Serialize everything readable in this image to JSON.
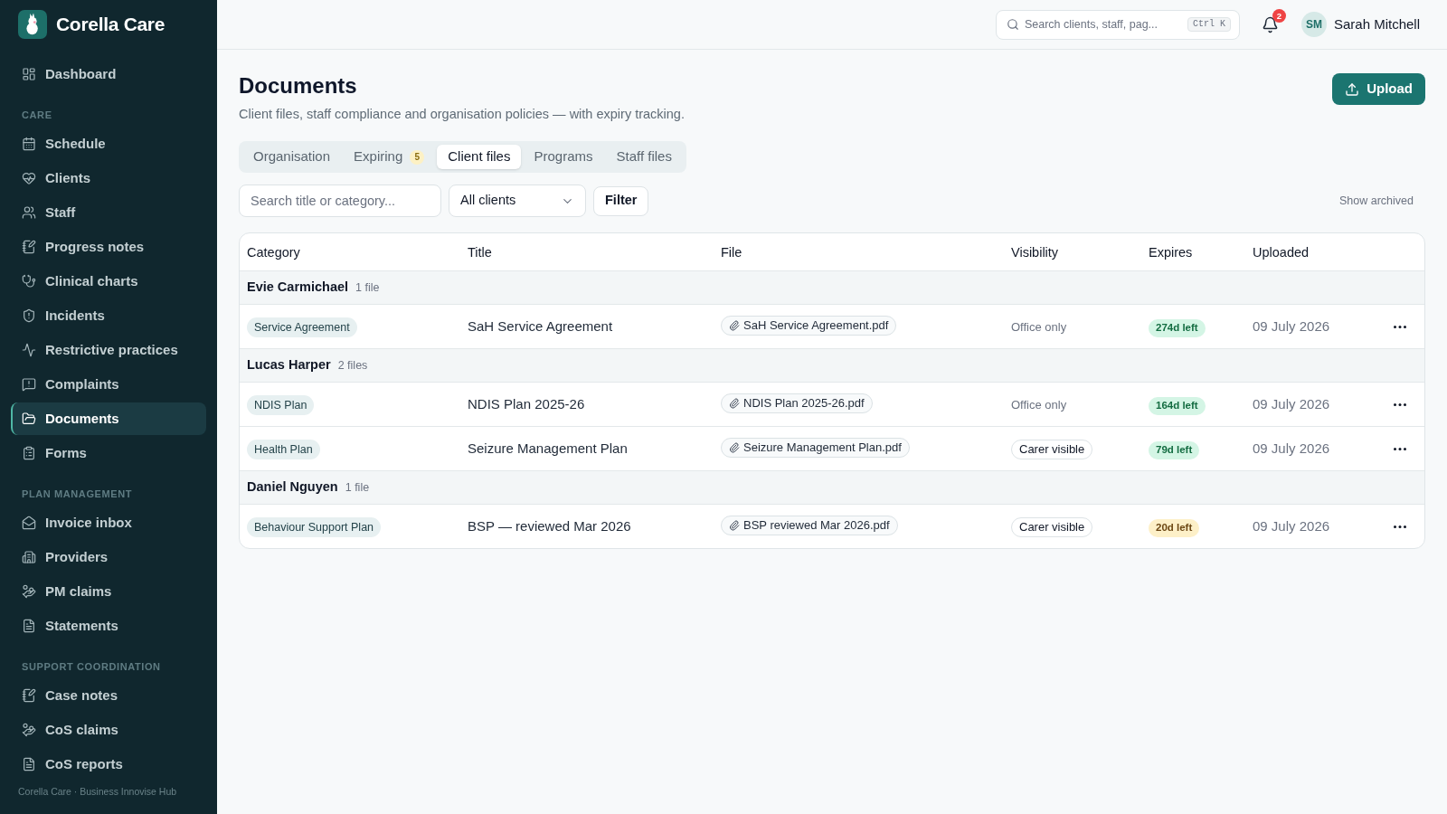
{
  "sidebar": {
    "brand": "Corella Care",
    "sections": [
      {
        "items": [
          {
            "label": "Dashboard",
            "selected": false
          }
        ]
      },
      {
        "heading": "CARE",
        "items": [
          {
            "label": "Schedule",
            "selected": false
          },
          {
            "label": "Clients",
            "selected": false
          },
          {
            "label": "Staff",
            "selected": false
          },
          {
            "label": "Progress notes",
            "selected": false
          },
          {
            "label": "Clinical charts",
            "selected": false
          },
          {
            "label": "Incidents",
            "selected": false
          },
          {
            "label": "Restrictive practices",
            "selected": false
          },
          {
            "label": "Complaints",
            "selected": false
          },
          {
            "label": "Documents",
            "selected": true
          },
          {
            "label": "Forms",
            "selected": false
          }
        ]
      },
      {
        "heading": "PLAN MANAGEMENT",
        "items": [
          {
            "label": "Invoice inbox",
            "selected": false
          },
          {
            "label": "Providers",
            "selected": false
          },
          {
            "label": "PM claims",
            "selected": false
          },
          {
            "label": "Statements",
            "selected": false
          }
        ]
      },
      {
        "heading": "SUPPORT COORDINATION",
        "items": [
          {
            "label": "Case notes",
            "selected": false
          },
          {
            "label": "CoS claims",
            "selected": false
          },
          {
            "label": "CoS reports",
            "selected": false
          }
        ]
      }
    ],
    "footer": "Corella Care · Business Innovise Hub"
  },
  "top_bar": {
    "search": {
      "placeholder": "Search clients, staff, pag...",
      "shortcut": "Ctrl K"
    },
    "notifications": {
      "count": "2"
    },
    "user": {
      "initials": "SM",
      "name": "Sarah Mitchell"
    }
  },
  "page": {
    "title": "Documents",
    "subtitle": "Client files, staff compliance and organisation policies — with expiry tracking.",
    "upload_button": "Upload",
    "tabs": [
      {
        "label": "Organisation",
        "selected": false
      },
      {
        "label": "Expiring",
        "badge": "5",
        "selected": false
      },
      {
        "label": "Client files",
        "selected": true
      },
      {
        "label": "Programs",
        "selected": false
      },
      {
        "label": "Staff files",
        "selected": false
      }
    ],
    "filters": {
      "search": {
        "placeholder": "Search title or category..."
      },
      "client_select": {
        "value": "All clients"
      },
      "filter_button": "Filter",
      "show_archived": "Show archived"
    },
    "table": {
      "columns": [
        "Category",
        "Title",
        "File",
        "Visibility",
        "Expires",
        "Uploaded"
      ],
      "groups": [
        {
          "name": "Evie Carmichael",
          "count": "1 file",
          "rows": [
            {
              "category": "Service Agreement",
              "title": "SaH Service Agreement",
              "file": "SaH Service Agreement.pdf",
              "visibility": {
                "text": "Office only",
                "kind": "plain"
              },
              "expires": {
                "text": "274d left",
                "color": "#d4f5e5"
              },
              "uploaded": "09 July 2026"
            }
          ]
        },
        {
          "name": "Lucas Harper",
          "count": "2 files",
          "rows": [
            {
              "category": "NDIS Plan",
              "title": "NDIS Plan 2025-26",
              "file": "NDIS Plan 2025-26.pdf",
              "visibility": {
                "text": "Office only",
                "kind": "plain"
              },
              "expires": {
                "text": "164d left",
                "color": "#d4f5e5"
              },
              "uploaded": "09 July 2026"
            },
            {
              "category": "Health Plan",
              "title": "Seizure Management Plan",
              "file": "Seizure Management Plan.pdf",
              "visibility": {
                "text": "Carer visible",
                "kind": "pill"
              },
              "expires": {
                "text": "79d left",
                "color": "#d4f5e5"
              },
              "uploaded": "09 July 2026"
            }
          ]
        },
        {
          "name": "Daniel Nguyen",
          "count": "1 file",
          "rows": [
            {
              "category": "Behaviour Support Plan",
              "title": "BSP — reviewed Mar 2026",
              "file": "BSP reviewed Mar 2026.pdf",
              "visibility": {
                "text": "Carer visible",
                "kind": "pill"
              },
              "expires": {
                "text": "20d left",
                "color": "#fdf0c8"
              },
              "uploaded": "09 July 2026"
            }
          ]
        }
      ]
    }
  }
}
